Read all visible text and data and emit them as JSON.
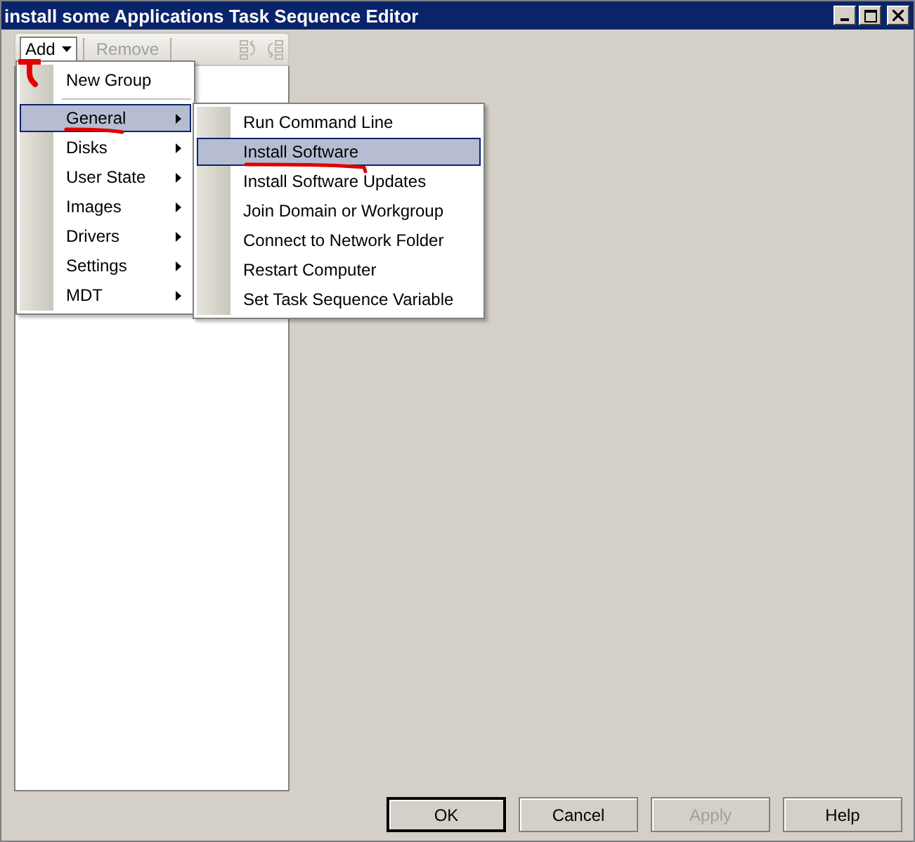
{
  "window": {
    "title": "install some Applications Task Sequence Editor"
  },
  "toolbar": {
    "add": {
      "label": "Add",
      "expanded": true
    },
    "remove": {
      "label": "Remove",
      "disabled": true
    },
    "tools": [
      {
        "kind": "move-up",
        "disabled": true
      },
      {
        "kind": "move-down",
        "disabled": true
      }
    ]
  },
  "menu": {
    "items": [
      {
        "kind": "item",
        "label": "New Group",
        "submenu": false,
        "selected": false
      },
      {
        "kind": "separator"
      },
      {
        "kind": "item",
        "label": "General",
        "submenu": true,
        "selected": true
      },
      {
        "kind": "item",
        "label": "Disks",
        "submenu": true,
        "selected": false
      },
      {
        "kind": "item",
        "label": "User State",
        "submenu": true,
        "selected": false
      },
      {
        "kind": "item",
        "label": "Images",
        "submenu": true,
        "selected": false
      },
      {
        "kind": "item",
        "label": "Drivers",
        "submenu": true,
        "selected": false
      },
      {
        "kind": "item",
        "label": "Settings",
        "submenu": true,
        "selected": false
      },
      {
        "kind": "item",
        "label": "MDT",
        "submenu": true,
        "selected": false
      }
    ]
  },
  "submenu": {
    "items": [
      {
        "label": "Run Command Line",
        "selected": false
      },
      {
        "label": "Install Software",
        "selected": true
      },
      {
        "label": "Install Software Updates",
        "selected": false
      },
      {
        "label": "Join Domain or Workgroup",
        "selected": false
      },
      {
        "label": "Connect to Network Folder",
        "selected": false
      },
      {
        "label": "Restart Computer",
        "selected": false
      },
      {
        "label": "Set Task Sequence Variable",
        "selected": false
      }
    ]
  },
  "buttons": [
    {
      "label": "OK",
      "default": true,
      "disabled": false
    },
    {
      "label": "Cancel",
      "default": false,
      "disabled": false
    },
    {
      "label": "Apply",
      "default": false,
      "disabled": true
    },
    {
      "label": "Help",
      "default": false,
      "disabled": false
    }
  ]
}
